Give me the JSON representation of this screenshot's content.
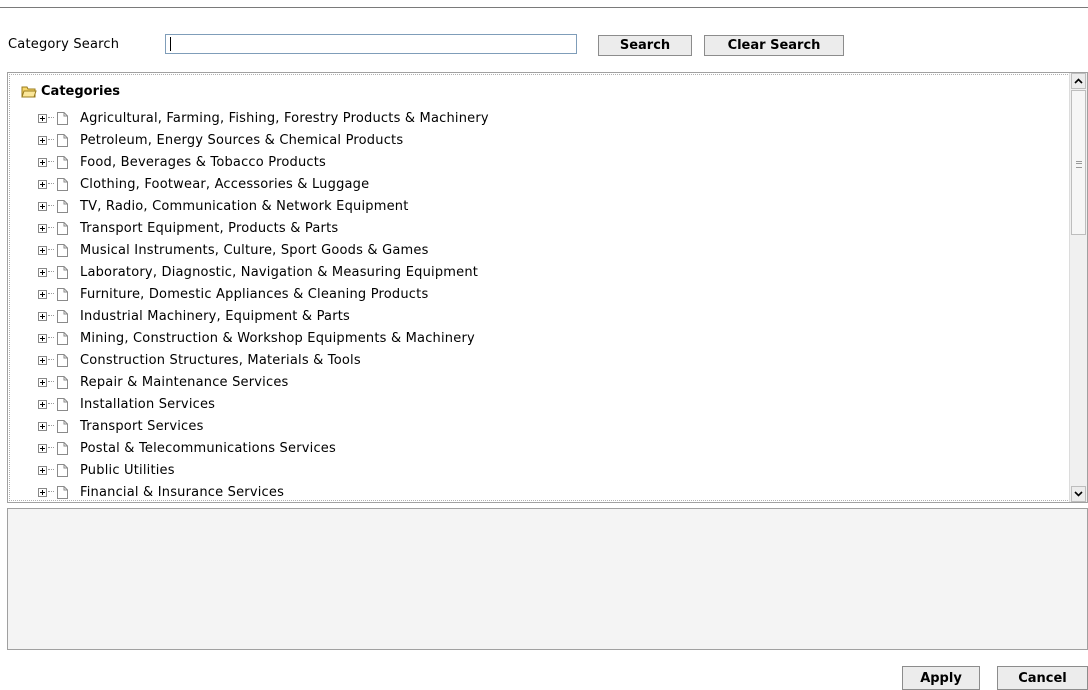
{
  "search": {
    "label": "Category Search",
    "value": "",
    "placeholder": "",
    "search_button": "Search",
    "clear_button": "Clear Search"
  },
  "tree": {
    "root_label": "Categories",
    "items": [
      "Agricultural, Farming, Fishing, Forestry Products & Machinery",
      "Petroleum, Energy Sources & Chemical Products",
      "Food, Beverages & Tobacco Products",
      "Clothing, Footwear, Accessories & Luggage",
      "TV, Radio, Communication & Network Equipment",
      "Transport Equipment, Products & Parts",
      "Musical Instruments, Culture, Sport Goods & Games",
      "Laboratory, Diagnostic, Navigation & Measuring Equipment",
      "Furniture, Domestic Appliances & Cleaning Products",
      "Industrial Machinery, Equipment & Parts",
      "Mining, Construction & Workshop Equipments & Machinery",
      "Construction Structures, Materials & Tools",
      "Repair & Maintenance Services",
      "Installation Services",
      "Transport Services",
      "Postal & Telecommunications Services",
      "Public Utilities",
      "Financial & Insurance Services"
    ]
  },
  "footer": {
    "apply_button": "Apply",
    "cancel_button": "Cancel"
  },
  "colors": {
    "folder": "#f2c94c",
    "border": "#a0a0a0",
    "button_bg": "#ececec"
  }
}
